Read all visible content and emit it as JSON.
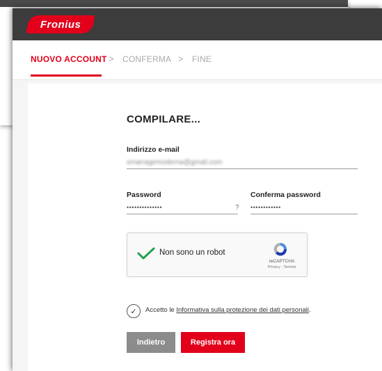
{
  "brand": {
    "logo_text": "Fronius",
    "color": "#e2001a"
  },
  "steps": {
    "items": [
      {
        "label": "NUOVO ACCOUNT",
        "state": "active"
      },
      {
        "label": "CONFERMA",
        "state": "inactive"
      },
      {
        "label": "FINE",
        "state": "inactive"
      }
    ],
    "separator": ">"
  },
  "form": {
    "title": "COMPILARE...",
    "email": {
      "label": "Indirizzo e-mail",
      "value": "smarragemoderna@gmail.com"
    },
    "password": {
      "label": "Password",
      "value": "••••••••••••••",
      "help": "?"
    },
    "confirm_password": {
      "label": "Conferma password",
      "value": "••••••••••••"
    }
  },
  "captcha": {
    "label": "Non sono un robot",
    "brand": "reCAPTCHA",
    "links": "Privacy - Termini",
    "checked": true
  },
  "consent": {
    "prefix": "Accetto le ",
    "link_text": "Informativa sulla protezione dei dati personali",
    "suffix": ".",
    "checked": true
  },
  "buttons": {
    "back_label": "Indietro",
    "register_label": "Registra ora"
  },
  "colors": {
    "accent": "#e2001a",
    "header": "#3c3c3c",
    "secondary_button": "#8c8c8c"
  }
}
